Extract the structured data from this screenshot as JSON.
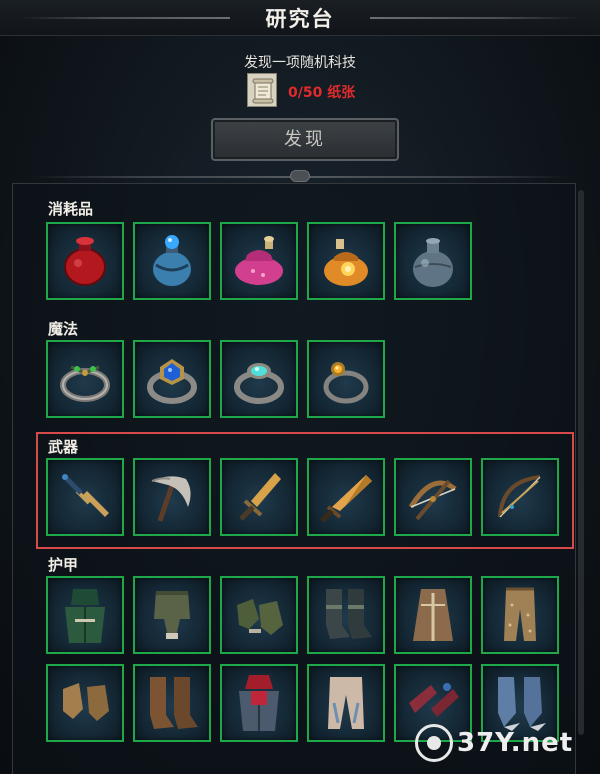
{
  "header": {
    "title": "研究台"
  },
  "discover": {
    "caption": "发现一项随机科技",
    "cost": "0/50 纸张",
    "button_label": "发现"
  },
  "categories": [
    {
      "label": "消耗品",
      "items": [
        "red-potion-icon",
        "blue-potion-icon",
        "pink-pouch-potion-icon",
        "orange-pouch-potion-icon",
        "grey-flask-icon"
      ]
    },
    {
      "label": "魔法",
      "items": [
        "green-gem-ring-icon",
        "blue-gem-ring-icon",
        "cyan-gem-ring-icon",
        "amber-gem-ring-icon"
      ]
    },
    {
      "label": "武器",
      "items": [
        "dagger-icon",
        "pickaxe-icon",
        "short-sword-icon",
        "broad-sword-icon",
        "crossbow-icon",
        "bow-icon"
      ]
    },
    {
      "label": "护甲",
      "items": [
        "hood-icon",
        "pants-icon",
        "gloves-icon",
        "boots-icon",
        "robe-icon",
        "leggings-icon",
        "gauntlets-icon",
        "tall-boots-icon",
        "red-armor-icon",
        "white-pants-icon",
        "arm-guards-icon",
        "plated-boots-icon"
      ]
    }
  ],
  "colors": {
    "slot_border": "#1fa84a",
    "highlight": "#d64a4a",
    "cost_text": "#e12b2b"
  },
  "watermark": "37Y.net"
}
